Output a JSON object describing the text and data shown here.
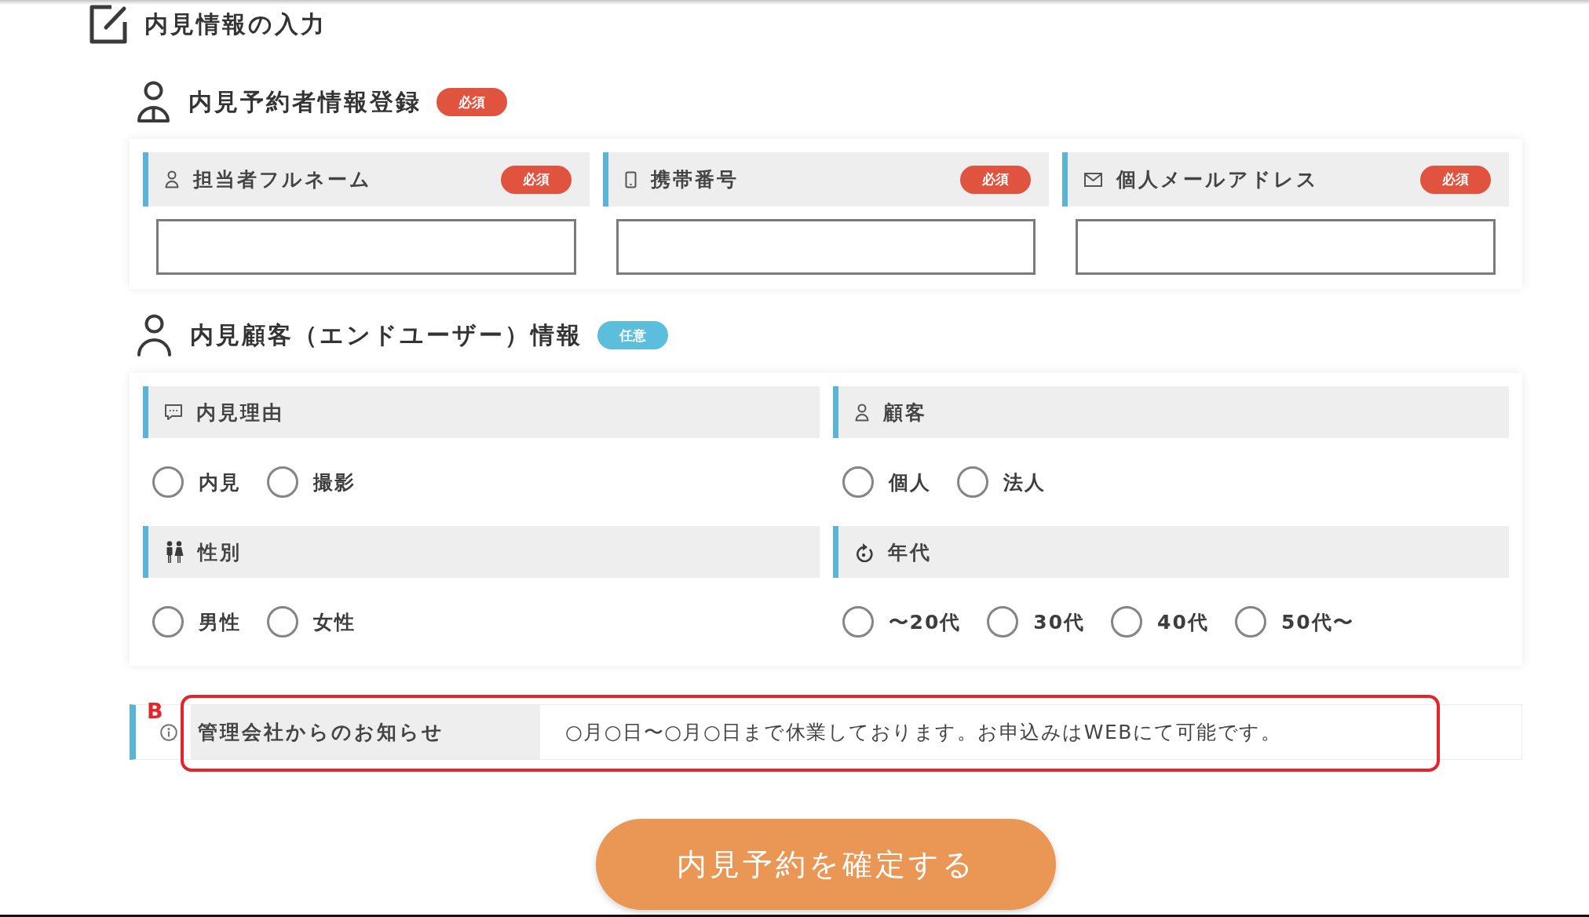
{
  "page_title": "内見情報の入力",
  "registrant_section": {
    "title": "内見予約者情報登録",
    "badge": {
      "text": "必須",
      "kind": "required"
    },
    "fields": [
      {
        "label": "担当者フルネーム",
        "badge": {
          "text": "必須",
          "kind": "required"
        }
      },
      {
        "label": "携帯番号",
        "badge": {
          "text": "必須",
          "kind": "required"
        }
      },
      {
        "label": "個人メールアドレス",
        "badge": {
          "text": "必須",
          "kind": "required"
        }
      }
    ]
  },
  "customer_section": {
    "title": "内見顧客（エンドユーザー）情報",
    "badge": {
      "text": "任意",
      "kind": "optional"
    },
    "groups": [
      {
        "label": "内見理由",
        "options": [
          {
            "label": "内見",
            "selected": false
          },
          {
            "label": "撮影",
            "selected": false
          }
        ]
      },
      {
        "label": "顧客",
        "options": [
          {
            "label": "個人",
            "selected": false
          },
          {
            "label": "法人",
            "selected": false
          }
        ]
      },
      {
        "label": "性別",
        "options": [
          {
            "label": "男性",
            "selected": false
          },
          {
            "label": "女性",
            "selected": false
          }
        ]
      },
      {
        "label": "年代",
        "options": [
          {
            "label": "〜20代",
            "selected": false
          },
          {
            "label": "30代",
            "selected": false
          },
          {
            "label": "40代",
            "selected": false
          },
          {
            "label": "50代〜",
            "selected": false
          }
        ]
      }
    ]
  },
  "notice": {
    "label": "管理会社からのお知らせ",
    "text": "○月○日〜○月○日まで休業しております。お申込みはWEBにて可能です。",
    "annotation": {
      "label": "B"
    }
  },
  "submit_button": {
    "label": "内見予約を確定する"
  }
}
